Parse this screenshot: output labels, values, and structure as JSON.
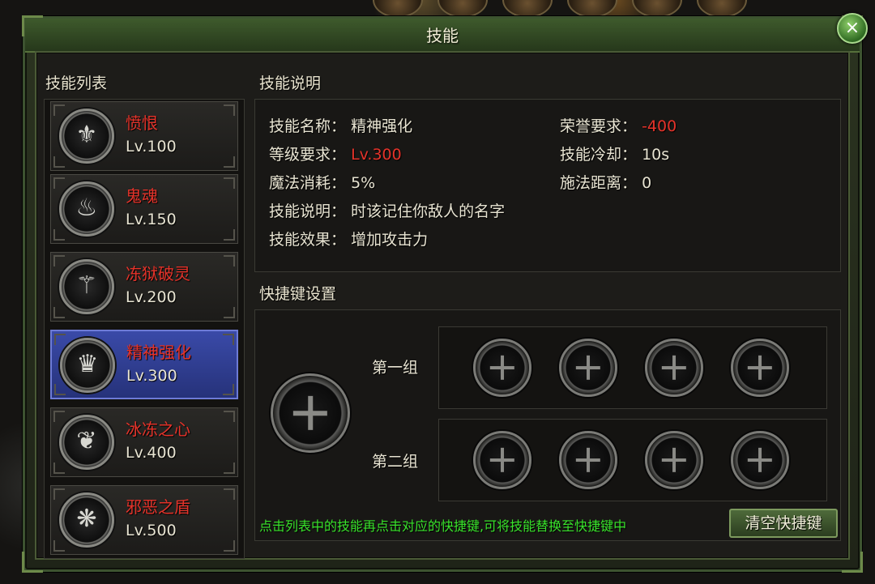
{
  "window": {
    "title": "技能",
    "close_icon": "×"
  },
  "skill_list": {
    "header": "技能列表",
    "items": [
      {
        "name": "愤恨",
        "level": "Lv.100",
        "icon": "⚜",
        "selected": false
      },
      {
        "name": "鬼魂",
        "level": "Lv.150",
        "icon": "♨",
        "selected": false
      },
      {
        "name": "冻狱破灵",
        "level": "Lv.200",
        "icon": "⚚",
        "selected": false
      },
      {
        "name": "精神强化",
        "level": "Lv.300",
        "icon": "♛",
        "selected": true
      },
      {
        "name": "冰冻之心",
        "level": "Lv.400",
        "icon": "❦",
        "selected": false
      },
      {
        "name": "邪恶之盾",
        "level": "Lv.500",
        "icon": "❋",
        "selected": false
      }
    ]
  },
  "description": {
    "header": "技能说明",
    "skill_name_label": "技能名称：",
    "skill_name_value": "精神强化",
    "level_req_label": "等级要求：",
    "level_req_value": "Lv.300",
    "mana_cost_label": "魔法消耗：",
    "mana_cost_value": "5%",
    "desc_label": "技能说明：",
    "desc_value": "时该记住你敌人的名字",
    "effect_label": "技能效果：",
    "effect_value": "增加攻击力",
    "honor_req_label": "荣誉要求：",
    "honor_req_value": "-400",
    "cooldown_label": "技能冷却：",
    "cooldown_value": "10s",
    "range_label": "施法距离：",
    "range_value": "0"
  },
  "hotkeys": {
    "header": "快捷键设置",
    "group1_label": "第一组",
    "group2_label": "第二组",
    "hint": "点击列表中的技能再点击对应的快捷键,可将技能替换至快捷键中",
    "clear_button": "清空快捷键"
  },
  "colors": {
    "skill_name_red": "#e5332a",
    "hint_green": "#39e22b",
    "selected_blue": "#3a4aa8",
    "frame_green": "#3e5a2c"
  }
}
